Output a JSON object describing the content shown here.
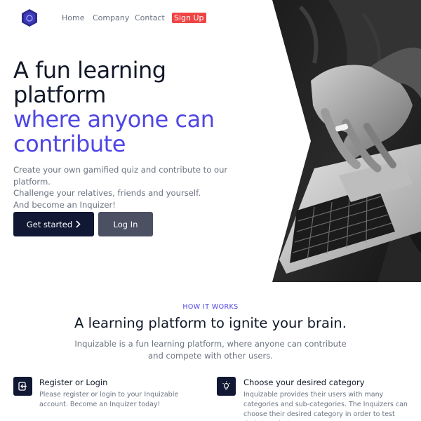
{
  "nav": {
    "links": [
      "Home",
      "Company",
      "Contact"
    ],
    "signup_label": "Sign Up"
  },
  "hero": {
    "title_lines": [
      "A fun learning",
      "platform"
    ],
    "title_accent_lines": [
      "where anyone can",
      "contribute"
    ],
    "lead_lines": [
      "Create your own gamified quiz and contribute to our platform.",
      "Challenge your relatives, friends and yourself.",
      "And become an Inquizer!"
    ],
    "get_started_label": "Get started",
    "login_label": "Log In"
  },
  "how_it_works": {
    "eyebrow": "HOW IT WORKS",
    "title": "A learning platform to ignite your brain.",
    "subtitle": "Inquizable is a fun learning platform, where anyone can contribute and compete with other users.",
    "features": [
      {
        "title": "Register or Login",
        "text": "Please register or login to your Inquizable account. Become an Inquizer today!",
        "icon": "login-icon"
      },
      {
        "title": "Choose your desired category",
        "text": "Inquizable provides their users with many categories and sub-categories. The Inquizers can choose their desired category in order to test their knowledge.",
        "icon": "lightbulb-icon"
      }
    ]
  },
  "colors": {
    "accent": "#4f46e5",
    "dark_button": "#111833",
    "secondary_button": "#4b5063",
    "signup": "#ef4444"
  }
}
